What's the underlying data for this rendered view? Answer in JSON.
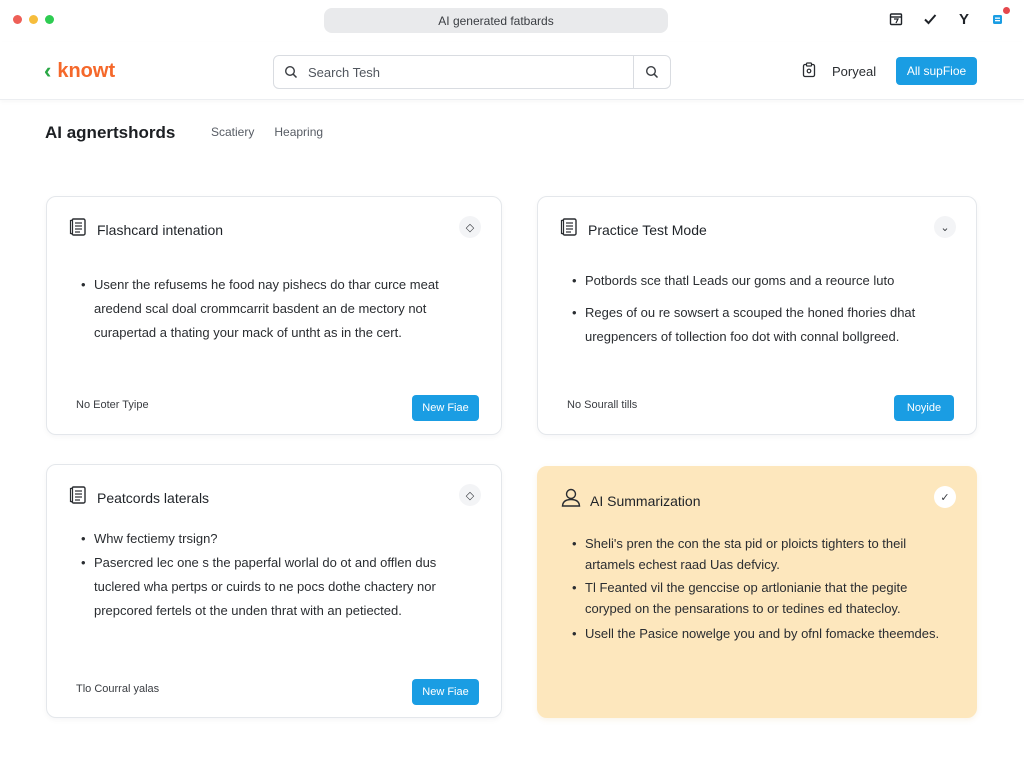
{
  "chrome": {
    "address": "AI generated fatbards",
    "dot_colors": [
      "#ee5f57",
      "#f6bd3c",
      "#2ecc52"
    ],
    "icons": [
      "calendar-icon",
      "check-icon",
      "y-icon",
      "extension-icon"
    ]
  },
  "header": {
    "logo_mark": "‹",
    "logo_text": "knowt",
    "search": {
      "placeholder": "Search Tesh"
    },
    "account_label": "Poryeal",
    "primary_button": "All supFioe"
  },
  "page": {
    "title": "AI agnertshords",
    "tabs": [
      "Scatiery",
      "Heapring"
    ]
  },
  "cards": [
    {
      "title": "Flashcard intenation",
      "bullets": [
        "Usenr the refusems he food nay pishecs do thar curce meat aredend scal doal crommcarrit basdent an de mectory not curapertad a thating your mack of untht as in the cert."
      ],
      "footer": "No Eoter Tyipe",
      "button": "New Fiae"
    },
    {
      "title": "Practice Test Mode",
      "bullets": [
        "Potbords sce thatl Leads our goms and a reource luto",
        "Reges of ou re sowsert a scouped the honed fhories dhat uregpencers of tollection foo dot with connal bollgreed."
      ],
      "footer": "No Sourall tills",
      "button": "Noyide"
    },
    {
      "title": "Peatcords laterals",
      "bullets": [
        "Whw fectiemy trsign?",
        "Pasercred lec one s the paperfal worlal do ot and offlen dus tuclered wha pertps or cuirds to ne pocs dothe chactery nor prepcored fertels ot the unden thrat with an petiected."
      ],
      "footer": "Tlo Courral yalas",
      "button": "New Fiae"
    },
    {
      "title": "AI Summarization",
      "bullets": [
        "Sheli's pren the con the sta pid or ploicts tighters to theil artamels echest raad Uas defvicy.",
        "Tl Feanted vil the genccise op artlonianie that the pegite coryped on the pensarations to or tedines ed thatecloy.",
        "Usell the Pasice nowelge you and by ofnl fomacke theemdes."
      ]
    }
  ]
}
